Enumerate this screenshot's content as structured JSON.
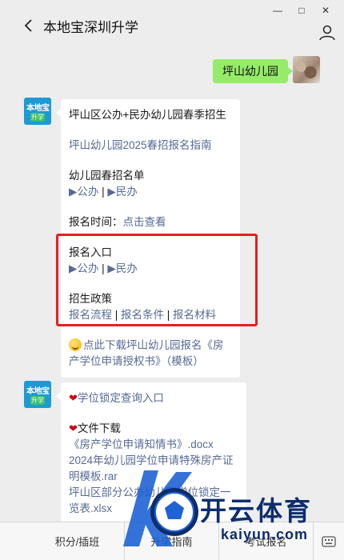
{
  "window": {
    "title": "本地宝深圳升学",
    "controls": {
      "minimize": "—",
      "maximize": "□",
      "close": "✕"
    }
  },
  "messages": {
    "user_message": "坪山幼儿园",
    "msg1": {
      "avatar_line1": "本地宝",
      "avatar_line2": "升学",
      "line1": "坪山区公办+民办幼儿园春季招生",
      "link_guide": "坪山幼儿园2025春招报名指南",
      "list_title": "幼儿园春招名单",
      "public": "▶公办",
      "sep": " | ",
      "private": "▶民办",
      "time_label": "报名时间：",
      "time_link": "点击查看",
      "entry_title": "报名入口",
      "entry_public": "▶公办",
      "entry_private": "▶民办",
      "policy_title": "招生政策",
      "policy_process": "报名流程",
      "policy_conditions": "报名条件",
      "policy_materials": "报名材料",
      "download_line1": "点此下载坪山幼儿园报名《房",
      "download_line2": "产学位申请授权书》（模板）"
    },
    "msg2": {
      "avatar_line1": "本地宝",
      "avatar_line2": "升学",
      "heart": "❤",
      "lock_query": "学位锁定查询入口",
      "file_title": "文件下载",
      "file1": "《房产学位申请知情书》.docx",
      "file2_line1": "2024年幼儿园学位申请特殊房产证",
      "file2_line2": "明模板.rar",
      "file3_line1": "坪山区部分公办幼儿园学位锁定一",
      "file3_line2": "览表.xlsx"
    }
  },
  "bottom_menu": {
    "tab1": "积分/插班",
    "tab2": "升学指南",
    "tab3": "考试报名"
  },
  "watermark": {
    "brand_cn": "开云体育",
    "brand_en": "kaiyun.com"
  },
  "colors": {
    "accent_link": "#576b95",
    "highlight_border": "#e32020",
    "bubble_green": "#95ec69"
  }
}
